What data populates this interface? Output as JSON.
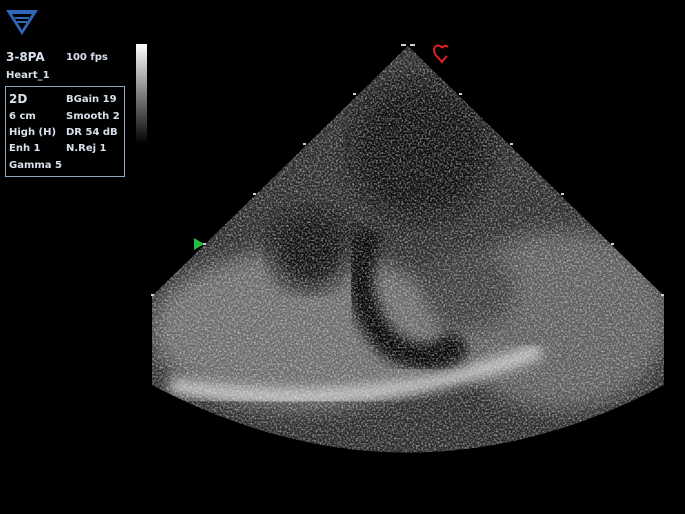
{
  "overlay": {
    "probe": "3-8PA",
    "frame_rate": "100 fps",
    "preset": "Heart_1",
    "params": {
      "mode": "2D",
      "depth": "6 cm",
      "freq": "High (H)",
      "enh": "Enh 1",
      "gamma": "Gamma 5",
      "bgain": "BGain 19",
      "smooth": "Smooth 2",
      "dr": "DR 54 dB",
      "nrej": "N.Rej 1"
    }
  },
  "icons": {
    "logo": "manufacturer-logo-icon",
    "orientation": "heart-orientation-icon",
    "focus": "focus-marker-icon"
  },
  "colors": {
    "logo": "#2f66b8",
    "orientation_marker": "#e02020",
    "focus_marker": "#22c040",
    "text": "#d8e0ec",
    "panel_border": "#8fa6bf"
  }
}
